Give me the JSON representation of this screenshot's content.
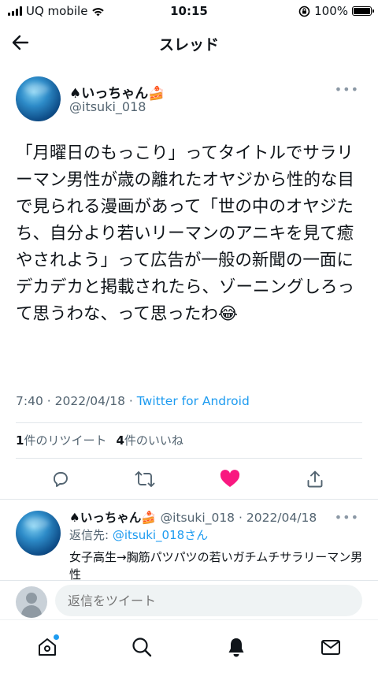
{
  "status_bar": {
    "carrier": "UQ mobile",
    "time": "10:15",
    "battery": "100%",
    "battery_level": 1.0
  },
  "header": {
    "title": "スレッド"
  },
  "main_tweet": {
    "display_name": "♠いっちゃん🍰",
    "handle": "@itsuki_018",
    "text": "「月曜日のもっこり」ってタイトルでサラリーマン男性が歳の離れたオヤジから性的な目で見られる漫画があって「世の中のオヤジたち、自分より若いリーマンのアニキを見て癒やされよう」って広告が一般の新聞の一面にデカデカと掲載されたら、ゾーニングしろって思うわな、って思ったわ😂",
    "time": "7:40",
    "date": "2022/04/18",
    "client": "Twitter for Android",
    "retweet_count": "1",
    "retweet_label": "件のリツイート",
    "like_count": "4",
    "like_label": "件のいいね",
    "liked": true
  },
  "reply_tweet": {
    "display_name": "♠いっちゃん🍰",
    "handle": "@itsuki_018",
    "date": "2022/04/18",
    "reply_to_prefix": "返信先: ",
    "reply_to_handle": "@itsuki_018さん",
    "text": "女子高生→胸筋パツパツの若いガチムチサラリーマン男性"
  },
  "composer": {
    "placeholder": "返信をツイート"
  },
  "bottom_nav": {
    "items": [
      "home-icon",
      "search-icon",
      "notifications-icon",
      "messages-icon"
    ],
    "active": "notifications-icon"
  },
  "colors": {
    "accent": "#1d9bf0",
    "like": "#f91880",
    "secondary_text": "#536471",
    "primary_text": "#0f1419"
  }
}
